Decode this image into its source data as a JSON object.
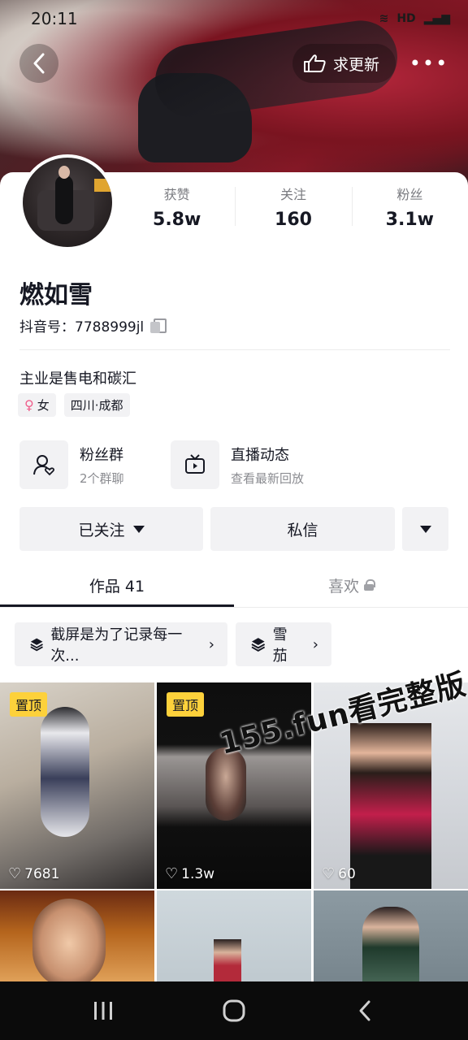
{
  "status_bar": {
    "time": "20:11",
    "signal_text": "HD"
  },
  "nav": {
    "update_label": "求更新"
  },
  "profile": {
    "stats": [
      {
        "label": "获赞",
        "value": "5.8w"
      },
      {
        "label": "关注",
        "value": "160"
      },
      {
        "label": "粉丝",
        "value": "3.1w"
      }
    ],
    "name": "燃如雪",
    "douyin_id": "抖音号：7788999jl",
    "bio": "主业是售电和碳汇",
    "tags": [
      "女",
      "四川·成都"
    ]
  },
  "features": [
    {
      "title": "粉丝群",
      "subtitle": "2个群聊",
      "icon": "fan-group-icon"
    },
    {
      "title": "直播动态",
      "subtitle": "查看最新回放",
      "icon": "tv-icon"
    }
  ],
  "actions": {
    "followed": "已关注",
    "message": "私信"
  },
  "tabs": [
    {
      "label": "作品 41"
    },
    {
      "label": "喜欢"
    }
  ],
  "collections": [
    {
      "label": "截屏是为了记录每一次..."
    },
    {
      "label": "雪茄"
    }
  ],
  "videos": [
    {
      "pinned_label": "置顶",
      "likes": "7681"
    },
    {
      "pinned_label": "置顶",
      "likes": "1.3w"
    },
    {
      "pinned_label": "",
      "likes": "60"
    }
  ],
  "watermark": "155.fun看完整版",
  "colors": {
    "pin": "#fdd13b",
    "accent_text": "#161823"
  }
}
